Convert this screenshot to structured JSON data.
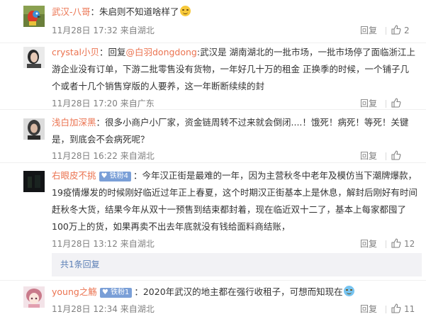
{
  "reply_label": "回复",
  "comments": [
    {
      "username": "武汉-八哥",
      "text": "：朱启则不知道啥样了",
      "time": "11月28日 17:32 来自湖北",
      "likes": "2",
      "avatar_icon": "parrot-avatar"
    },
    {
      "username": "crystal小贝",
      "reply_prefix": "：回复",
      "reply_to": "@白羽dongdong",
      "text": ":武汉是 湖南湖北的一批市场，一批市场停了面临浙江上游企业没有订单，下游二批零售没有货物，一年好几十万的租金 正换季的时候，一个铺子几个或者十几个销售穿版的人要养，这一年断断续续的封",
      "time": "11月28日 17:20 来自广东",
      "likes": "",
      "avatar_icon": "portrait-avatar"
    },
    {
      "username": "浅白加深黑",
      "text": "：很多小商户小厂家，资金链周转不过来就会倒闭....！饿死！病死！等死！关键是，到底会不会病死呢？",
      "time": "11月28日 16:22 来自湖北",
      "likes": "",
      "avatar_icon": "portrait-avatar"
    },
    {
      "username": "右眼皮不挑",
      "badge": "铁粉4",
      "text": "：今年汉正街是最难的一年，因为主营秋冬中老年及模仿当下潮牌爆款，19疫情爆发的时候刚好临近过年正上春夏，这个时期汉正街基本上是休息，解封后刚好有时间赶秋冬大货，结果今年从双十一预售到结束都封着，现在临近双十二了，基本上每家都囤了100万上的货，如果再卖不出去年底就没有钱给面料商结账，",
      "time": "11月28日 13:12 来自湖北",
      "likes": "12",
      "avatar_icon": "dark-photo-avatar"
    },
    {
      "username": "young之觞",
      "badge": "铁粉1",
      "text": "：2020年武汉的地主都在强行收租子，可想而知现在",
      "time": "11月28日 12:34 来自湖北",
      "likes": "11",
      "avatar_icon": "anime-avatar"
    }
  ],
  "more_replies": "共1条回复"
}
